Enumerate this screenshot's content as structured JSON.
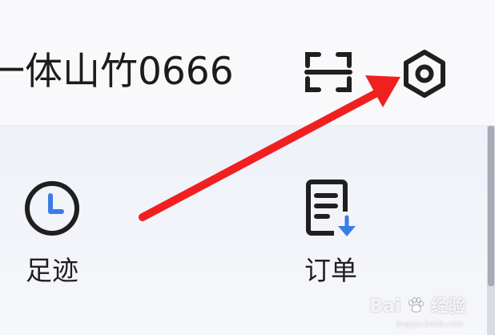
{
  "header": {
    "username": "一体山竹0666",
    "scan_icon": "scan-icon",
    "settings_icon": "settings-hexagon-icon"
  },
  "shortcuts": [
    {
      "label": "足迹",
      "icon": "clock-icon"
    },
    {
      "label": "订单",
      "icon": "order-list-icon"
    }
  ],
  "annotation": {
    "type": "red-arrow",
    "color": "#f02020",
    "points_to": "settings-button"
  },
  "colors": {
    "accent_blue": "#3b7be8",
    "icon_dark": "#1f1f1f",
    "arrow_red": "#f02020"
  },
  "watermark": {
    "brand": "Bai",
    "brand_suffix": "经验",
    "sub": "jingyan.baidu.com"
  }
}
